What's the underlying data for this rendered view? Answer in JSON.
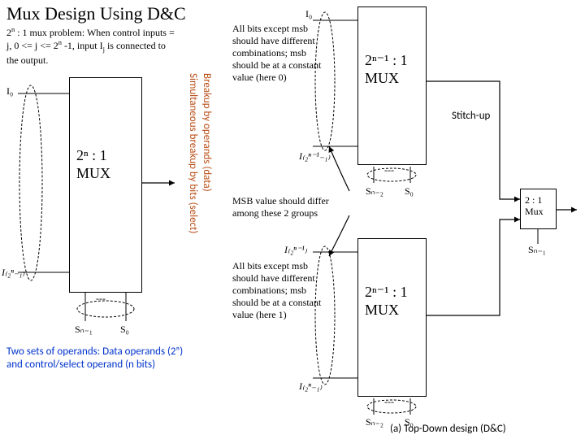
{
  "title": "Mux Design Using D&C",
  "problem_html": "2<sup>n</sup> : 1 mux problem: When control inputs = j, 0 <= j <= 2<sup>n</sup> -1, input I<sub>j</sub> is connected to the output.",
  "left": {
    "i0": "I₀",
    "i2n1": "I₍₂ⁿ₋₁₎",
    "mux_line1": "2ⁿ : 1",
    "mux_line2": "MUX",
    "sel_dashes": "---",
    "sel_left": "Sₙ₋₁",
    "sel_right": "S₀"
  },
  "vertical": {
    "line1": "Breakup by operands (data)",
    "line2": "Simultaneous breakup by bits (select)"
  },
  "two_sets": "Two sets of operands: Data operands (2ⁿ) and control/select operand (n bits)",
  "mid": {
    "top_i0": "I₀",
    "top_note": "All bits except msb should have different combinations; msb should be at a constant value (here 0)",
    "top_last": "I₍₂ⁿ⁻¹₋₁₎",
    "msb_diff": "MSB value should differ among these 2 groups",
    "bot_first": "I₍₂ⁿ⁻¹₎",
    "bot_note": "All bits except msb should have different combinations; msb should be at a constant value (here 1)",
    "bot_last": "I₍₂ⁿ₋₁₎"
  },
  "right": {
    "mux_line1": "2ⁿ⁻¹ : 1",
    "mux_line2": "MUX",
    "sel_dashes": "---",
    "sel_left": "Sₙ₋₂",
    "sel_right": "S₀",
    "stitch": "Stitch-up",
    "final_line1": "2 : 1",
    "final_line2": "Mux",
    "final_out": "Sₙ₋₁"
  },
  "caption": "(a) Top-Down design (D&C)"
}
